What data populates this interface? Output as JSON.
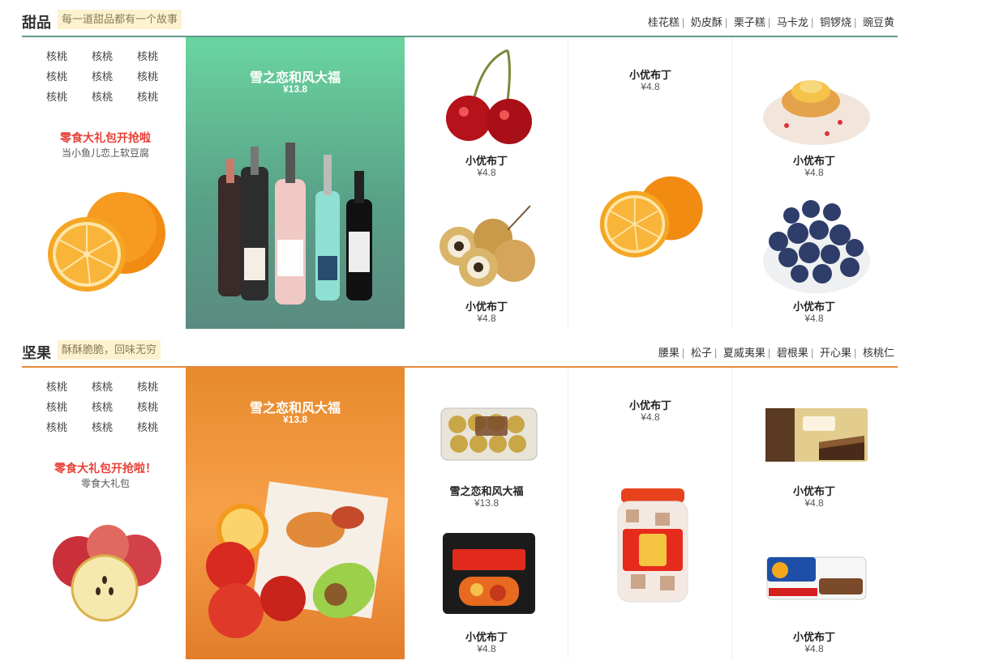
{
  "section1": {
    "title": "甜品",
    "slogan": "每一道甜品都有一个故事",
    "tags": [
      "桂花糕",
      "奶皮酥",
      "栗子糕",
      "马卡龙",
      "铜锣烧",
      "豌豆黄"
    ],
    "keywords": [
      "核桃",
      "核桃",
      "核桃",
      "核桃",
      "核桃",
      "核桃",
      "核桃",
      "核桃",
      "核桃"
    ],
    "promo_title": "零食大礼包开抢啦",
    "promo_sub": "当小鱼儿恋上软豆腐",
    "left_image": "orange-image",
    "banner": {
      "title": "雪之恋和风大福",
      "price": "¥13.8",
      "image": "wine-bottles-image"
    },
    "products": [
      {
        "name": "小优布丁",
        "price": "¥4.8",
        "image": "cherry-image"
      },
      {
        "name": "小优布丁",
        "price": "¥4.8",
        "image": "longan-image"
      },
      {
        "name": "小优布丁",
        "price": "¥4.8",
        "image": "orange-image"
      },
      {
        "name": "小优布丁",
        "price": "¥4.8",
        "image": "pancake-image"
      },
      {
        "name": "小优布丁",
        "price": "¥4.8",
        "image": "blueberry-image"
      }
    ]
  },
  "section2": {
    "title": "坚果",
    "slogan": "酥酥脆脆，回味无穷",
    "tags": [
      "腰果",
      "松子",
      "夏威夷果",
      "碧根果",
      "开心果",
      "核桃仁"
    ],
    "keywords": [
      "核桃",
      "核桃",
      "核桃",
      "核桃",
      "核桃",
      "核桃",
      "核桃",
      "核桃",
      "核桃"
    ],
    "promo_title": "零食大礼包开抢啦！",
    "promo_sub": "零食大礼包",
    "left_image": "apple-image",
    "banner": {
      "title": "雪之恋和风大福",
      "price": "¥13.8",
      "image": "food-platter-image"
    },
    "products": [
      {
        "name": "雪之恋和风大福",
        "price": "¥13.8",
        "image": "chocolate-box-image"
      },
      {
        "name": "小优布丁",
        "price": "¥4.8",
        "image": "ramen-pack-image"
      },
      {
        "name": "小优布丁",
        "price": "¥4.8",
        "image": "candy-jar-image"
      },
      {
        "name": "小优布丁",
        "price": "¥4.8",
        "image": "fudo-cake-image"
      },
      {
        "name": "小优布丁",
        "price": "¥4.8",
        "image": "kinder-bueno-image"
      }
    ]
  },
  "colors": {
    "accent_green": "#5f9a8a",
    "accent_orange": "#e3893a",
    "promo_red": "#e84037",
    "slogan_bg": "#fdf2cf"
  }
}
